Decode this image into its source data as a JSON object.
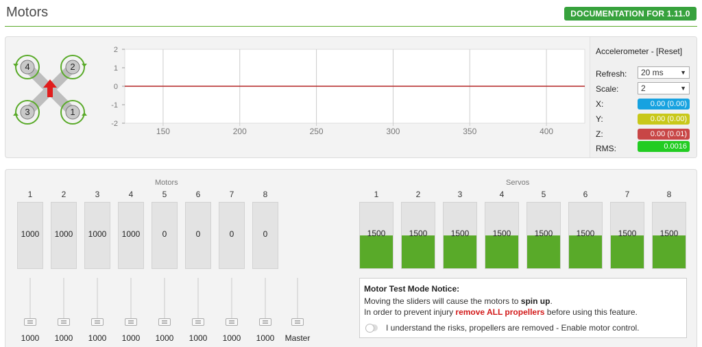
{
  "header": {
    "title": "Motors",
    "doc_button": "DOCUMENTATION FOR 1.11.0"
  },
  "quad": {
    "motors": [
      "4",
      "2",
      "3",
      "1"
    ],
    "accent": "#59aa29",
    "arrow_color": "#e01c1c",
    "icons": [
      "quad-frame-icon",
      "rotation-arrow-icon",
      "direction-arrow-icon"
    ]
  },
  "graph": {
    "y_ticks": [
      "2",
      "1",
      "0",
      "-1",
      "-2"
    ],
    "x_ticks": [
      "150",
      "200",
      "250",
      "300",
      "350",
      "400"
    ],
    "line_color": "#b22222"
  },
  "chart_data": {
    "type": "line",
    "title": "",
    "xlabel": "",
    "ylabel": "",
    "x": [
      125,
      425
    ],
    "series": [
      {
        "values": [
          0,
          0
        ]
      }
    ],
    "xlim": [
      125,
      425
    ],
    "ylim": [
      -2,
      2
    ],
    "grid": true
  },
  "accel": {
    "title": "Accelerometer - [Reset]",
    "refresh_label": "Refresh:",
    "refresh_value": "20 ms",
    "scale_label": "Scale:",
    "scale_value": "2",
    "x_label": "X:",
    "x_value": "0.00 (0.00)",
    "x_color": "#17a2e0",
    "y_label": "Y:",
    "y_value": "0.00 (0.00)",
    "y_color": "#c8c81a",
    "z_label": "Z:",
    "z_value": "0.00 (0.01)",
    "z_color": "#c84646",
    "rms_label": "RMS:",
    "rms_value": "0.0016",
    "rms_color": "#22cc22"
  },
  "motors": {
    "label": "Motors",
    "columns": [
      {
        "num": "1",
        "value": "1000",
        "slider": "1000"
      },
      {
        "num": "2",
        "value": "1000",
        "slider": "1000"
      },
      {
        "num": "3",
        "value": "1000",
        "slider": "1000"
      },
      {
        "num": "4",
        "value": "1000",
        "slider": "1000"
      },
      {
        "num": "5",
        "value": "0",
        "slider": "1000"
      },
      {
        "num": "6",
        "value": "0",
        "slider": "1000"
      },
      {
        "num": "7",
        "value": "0",
        "slider": "1000"
      },
      {
        "num": "8",
        "value": "0",
        "slider": "1000"
      }
    ],
    "master_label": "Master"
  },
  "servos": {
    "label": "Servos",
    "columns": [
      {
        "num": "1",
        "value": "1500",
        "level": 0.5
      },
      {
        "num": "2",
        "value": "1500",
        "level": 0.5
      },
      {
        "num": "3",
        "value": "1500",
        "level": 0.5
      },
      {
        "num": "4",
        "value": "1500",
        "level": 0.5
      },
      {
        "num": "5",
        "value": "1500",
        "level": 0.5
      },
      {
        "num": "6",
        "value": "1500",
        "level": 0.5
      },
      {
        "num": "7",
        "value": "1500",
        "level": 0.5
      },
      {
        "num": "8",
        "value": "1500",
        "level": 0.5
      }
    ]
  },
  "notice": {
    "title": "Motor Test Mode Notice:",
    "line1_a": "Moving the sliders will cause the motors to ",
    "line1_b": "spin up",
    "line1_c": ".",
    "line2_a": "In order to prevent injury ",
    "line2_b": "remove ALL propellers",
    "line2_c": " before using this feature.",
    "toggle_label": "I understand the risks, propellers are removed - Enable motor control."
  }
}
